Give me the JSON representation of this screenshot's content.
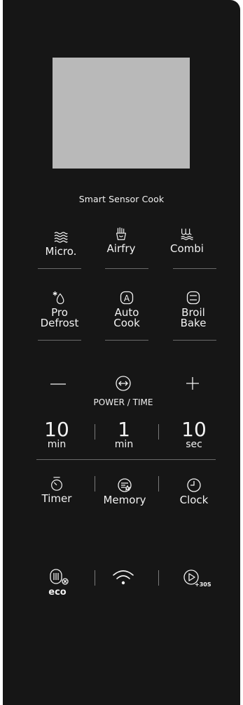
{
  "panel": {
    "sensor_label": "Smart Sensor Cook"
  },
  "modes": {
    "micro": {
      "label": "Micro.",
      "icon": "waves-icon"
    },
    "airfry": {
      "label": "Airfry",
      "icon": "fries-icon"
    },
    "combi": {
      "label": "Combi",
      "icon": "combi-waves-icon"
    }
  },
  "programs": {
    "pro_defrost": {
      "line1": "Pro",
      "line2": "Defrost",
      "icon": "snowflake-drop-icon"
    },
    "auto_cook": {
      "line1": "Auto",
      "line2": "Cook",
      "icon": "letter-a-icon"
    },
    "broil_bake": {
      "line1": "Broil",
      "line2": "Bake",
      "icon": "oven-icon"
    }
  },
  "power_time": {
    "label": "POWER / TIME",
    "minus": "—",
    "plus": "+"
  },
  "time_keys": [
    {
      "value": "10",
      "unit": "min"
    },
    {
      "value": "1",
      "unit": "min"
    },
    {
      "value": "10",
      "unit": "sec"
    }
  ],
  "functions": {
    "timer": {
      "label": "Timer",
      "icon": "stopwatch-icon"
    },
    "memory": {
      "label": "Memory",
      "icon": "memory-icon"
    },
    "clock": {
      "label": "Clock",
      "icon": "clock-icon"
    }
  },
  "bottom": {
    "eco": {
      "label": "eco",
      "icon": "eco-icon"
    },
    "wifi": {
      "icon": "wifi-icon"
    },
    "start": {
      "label": "+30S",
      "icon": "play-plus30-icon"
    }
  },
  "colors": {
    "panel": "#161616",
    "display": "#b9b9b9",
    "text": "#f2f2f2"
  }
}
